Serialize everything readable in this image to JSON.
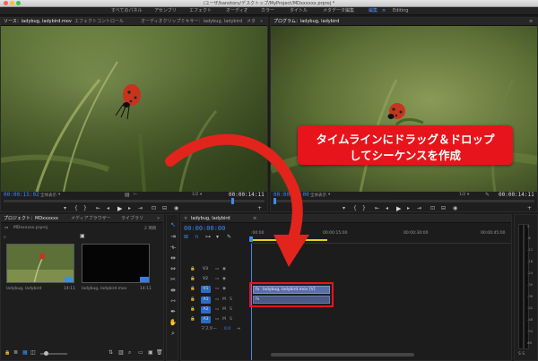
{
  "window": {
    "title": "/ユーザ/kanotoru/デスクトップ/MyProject/MDxxxxxx.prproj *"
  },
  "workspaces": [
    {
      "label": "すべてのパネル",
      "active": false
    },
    {
      "label": "アセンブリ",
      "active": false
    },
    {
      "label": "エフェクト",
      "active": false
    },
    {
      "label": "オーディオ",
      "active": false
    },
    {
      "label": "カラー",
      "active": false
    },
    {
      "label": "タイトル",
      "active": false
    },
    {
      "label": "メタデータ編集",
      "active": false
    },
    {
      "label": "編集",
      "active": true
    },
    {
      "label": "≡",
      "active": false
    },
    {
      "label": "Editing",
      "active": false
    }
  ],
  "source": {
    "tabs": [
      "ソース：ladybug, ladybird.mov",
      "エフェクトコントロール",
      "オーディオクリップミキサー：ladybug, ladybird",
      "メタ"
    ],
    "timecode_in": "00:00:15:02",
    "zoom": "全体表示",
    "fraction": "1/2",
    "timecode_dur": "00:00:14:11"
  },
  "program": {
    "tab": "プログラム：ladybug, ladybird",
    "timecode_in": "00:00:00:00",
    "zoom": "全体表示",
    "fraction": "1/2",
    "timecode_dur": "00:00:14:11"
  },
  "project": {
    "tabs": [
      "プロジェクト：MDxxxxxx",
      "メディアブラウザー",
      "ライブラリ"
    ],
    "file": "MDxxxxxx.prproj",
    "count": "2 項目",
    "items": [
      {
        "name": "ladybug, ladybird",
        "duration": "14:11"
      },
      {
        "name": "ladybug, ladybird.mov",
        "duration": "14:11"
      }
    ]
  },
  "timeline": {
    "tab": "ladybug, ladybird",
    "timecode": "00:00:00:00",
    "ruler": [
      ":00:00",
      "00:00:15:00",
      "00:00:30:00",
      "00:00:45:00"
    ],
    "video_tracks": [
      "V3",
      "V2",
      "V1"
    ],
    "audio_tracks": [
      "A1",
      "A2",
      "A3"
    ],
    "master": "マスター",
    "master_val": "0.0",
    "clip_label": "ladybug, ladybird.mov [V]",
    "audio_clip_label": "fx"
  },
  "callout": {
    "line1": "タイムラインにドラッグ＆ドロップ",
    "line2": "してシーケンスを作成"
  },
  "meter_labels": [
    "0",
    "-6",
    "-12",
    "-18",
    "-24",
    "-30",
    "-36",
    "-42",
    "-48",
    "-54",
    "dB"
  ],
  "meter_bottom": "S S",
  "colors": {
    "accent": "#3d8bf2",
    "callout_bg": "#e8141b",
    "arrow": "#e3241c",
    "clip_video": "#5a6ea8",
    "clip_audio": "#4a5a86"
  }
}
